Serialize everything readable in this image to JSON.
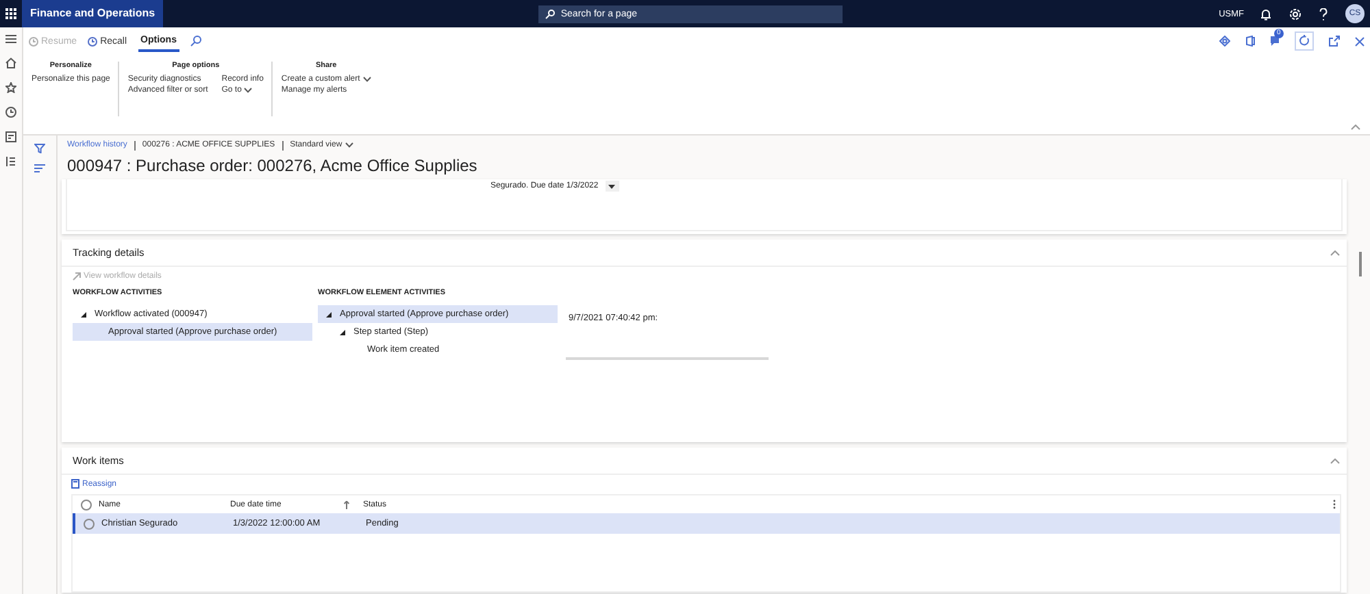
{
  "top_bar": {
    "app_title": "Finance and Operations",
    "search": {
      "placeholder": "Search for a page"
    },
    "company": "USMF",
    "avatar_initials": "CS"
  },
  "action_pane": {
    "buttons": [
      {
        "label": "Resume",
        "disabled": true
      },
      {
        "label": "Recall",
        "disabled": false
      }
    ],
    "tabs": [
      {
        "label": "Options",
        "selected": true
      }
    ],
    "notification_count": "0",
    "groups": [
      {
        "title": "Personalize",
        "columns": [
          [
            {
              "label": "Personalize this page",
              "dropdown": false
            }
          ]
        ]
      },
      {
        "title": "Page options",
        "columns": [
          [
            {
              "label": "Security diagnostics",
              "dropdown": false
            },
            {
              "label": "Advanced filter or sort",
              "dropdown": false
            }
          ],
          [
            {
              "label": "Record info",
              "dropdown": false
            },
            {
              "label": "Go to",
              "dropdown": true
            }
          ]
        ]
      },
      {
        "title": "Share",
        "columns": [
          [
            {
              "label": "Create a custom alert",
              "dropdown": true
            },
            {
              "label": "Manage my alerts",
              "dropdown": false
            }
          ]
        ]
      }
    ]
  },
  "breadcrumb": [
    {
      "text": "Workflow history",
      "kind": "link"
    },
    {
      "text": "000276 : ACME OFFICE SUPPLIES",
      "kind": "text"
    },
    {
      "text": "Standard view",
      "kind": "dropdown"
    }
  ],
  "page_title": "000947 : Purchase order: 000276, Acme Office Supplies",
  "summary_card": {
    "text": "Segurado. Due date 1/3/2022"
  },
  "tracking": {
    "title": "Tracking details",
    "expanded": true,
    "action": {
      "label": "View workflow details",
      "disabled": true
    },
    "workflow_activities": {
      "heading": "WORKFLOW ACTIVITIES",
      "items": [
        {
          "label": "Workflow activated (000947)",
          "expanded": true,
          "selected": false,
          "children": [
            {
              "label": "Approval started (Approve purchase order)",
              "expanded": false,
              "selected": true
            }
          ]
        }
      ]
    },
    "element_activities": {
      "heading": "WORKFLOW ELEMENT ACTIVITIES",
      "items": [
        {
          "label": "Approval started (Approve purchase order)",
          "expanded": true,
          "selected": true,
          "children": [
            {
              "label": "Step started (Step)",
              "expanded": true,
              "selected": false,
              "children": [
                {
                  "label": "Work item created",
                  "expanded": false,
                  "selected": false
                }
              ]
            }
          ]
        }
      ]
    },
    "timestamp": "9/7/2021 07:40:42 pm:"
  },
  "work_items": {
    "title": "Work items",
    "expanded": true,
    "action": "Reassign",
    "select_all_checked": false,
    "columns": [
      {
        "label": "Name",
        "sorted": false
      },
      {
        "label": "Due date time",
        "sorted": true
      },
      {
        "label": "Status",
        "sorted": false
      }
    ],
    "rows": [
      {
        "selected": true,
        "checked": false,
        "cells": [
          "Christian Segurado",
          "1/3/2022 12:00:00 AM",
          "Pending"
        ]
      }
    ]
  }
}
